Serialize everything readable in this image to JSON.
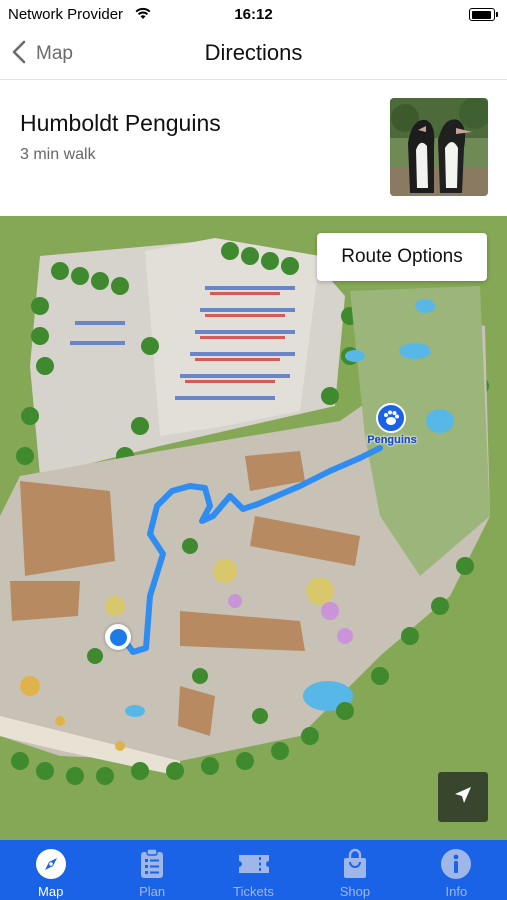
{
  "status_bar": {
    "carrier": "Network Provider",
    "time": "16:12",
    "wifi_icon": "wifi-icon",
    "battery_icon": "battery-icon"
  },
  "nav": {
    "back_label": "Map",
    "back_icon": "chevron-left-icon",
    "title": "Directions"
  },
  "destination": {
    "name": "Humboldt Penguins",
    "walk_time": "3 min walk",
    "photo": "penguins-photo"
  },
  "map": {
    "route_options_label": "Route Options",
    "destination_marker_label": "Penguins",
    "destination_icon": "paw-icon",
    "locate_icon": "location-arrow-icon",
    "route_color": "#2f8cf0",
    "user_dot_color": "#1e7ae6"
  },
  "tabs": [
    {
      "label": "Map",
      "icon": "compass-icon",
      "active": true
    },
    {
      "label": "Plan",
      "icon": "checklist-icon",
      "active": false
    },
    {
      "label": "Tickets",
      "icon": "ticket-icon",
      "active": false
    },
    {
      "label": "Shop",
      "icon": "shopping-bag-icon",
      "active": false
    },
    {
      "label": "Info",
      "icon": "info-icon",
      "active": false
    }
  ],
  "colors": {
    "tab_bar": "#1b63e6",
    "tab_active": "#ffffff",
    "tab_inactive": "#9fb6e8",
    "map_grass": "#7fa24f"
  }
}
